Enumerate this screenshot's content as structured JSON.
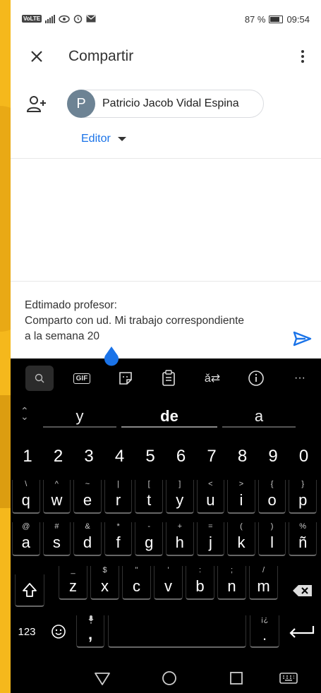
{
  "status": {
    "battery": "87 %",
    "time": "09:54",
    "volte": "VoLTE"
  },
  "appbar": {
    "title": "Compartir"
  },
  "recipient": {
    "avatar_initial": "P",
    "name": "Patricio Jacob Vidal Espina",
    "role": "Editor"
  },
  "message": {
    "line1": "Edtimado profesor:",
    "line2": "Comparto con ud. Mi trabajo correspondiente",
    "line3": "a la semana 20"
  },
  "keyboard": {
    "toolbar": {
      "gif": "GIF",
      "more": "···"
    },
    "suggestions": [
      "y",
      "de",
      "a"
    ],
    "numbers": [
      "1",
      "2",
      "3",
      "4",
      "5",
      "6",
      "7",
      "8",
      "9",
      "0"
    ],
    "row1": [
      {
        "k": "q",
        "s": "\\"
      },
      {
        "k": "w",
        "s": "^"
      },
      {
        "k": "e",
        "s": "~"
      },
      {
        "k": "r",
        "s": "|"
      },
      {
        "k": "t",
        "s": "["
      },
      {
        "k": "y",
        "s": "]"
      },
      {
        "k": "u",
        "s": "<"
      },
      {
        "k": "i",
        "s": ">"
      },
      {
        "k": "o",
        "s": "{"
      },
      {
        "k": "p",
        "s": "}"
      }
    ],
    "row2": [
      {
        "k": "a",
        "s": "@"
      },
      {
        "k": "s",
        "s": "#"
      },
      {
        "k": "d",
        "s": "&"
      },
      {
        "k": "f",
        "s": "*"
      },
      {
        "k": "g",
        "s": "-"
      },
      {
        "k": "h",
        "s": "+"
      },
      {
        "k": "j",
        "s": "="
      },
      {
        "k": "k",
        "s": "("
      },
      {
        "k": "l",
        "s": ")"
      },
      {
        "k": "ñ",
        "s": "%"
      }
    ],
    "row3": [
      {
        "k": "z",
        "s": "_"
      },
      {
        "k": "x",
        "s": "$"
      },
      {
        "k": "c",
        "s": "\""
      },
      {
        "k": "v",
        "s": "'"
      },
      {
        "k": "b",
        "s": ":"
      },
      {
        "k": "n",
        "s": ";"
      },
      {
        "k": "m",
        "s": "/"
      }
    ],
    "bottom": {
      "sym": "123",
      "comma": ",",
      "period": ".",
      "period_alt": "¡¿"
    }
  }
}
